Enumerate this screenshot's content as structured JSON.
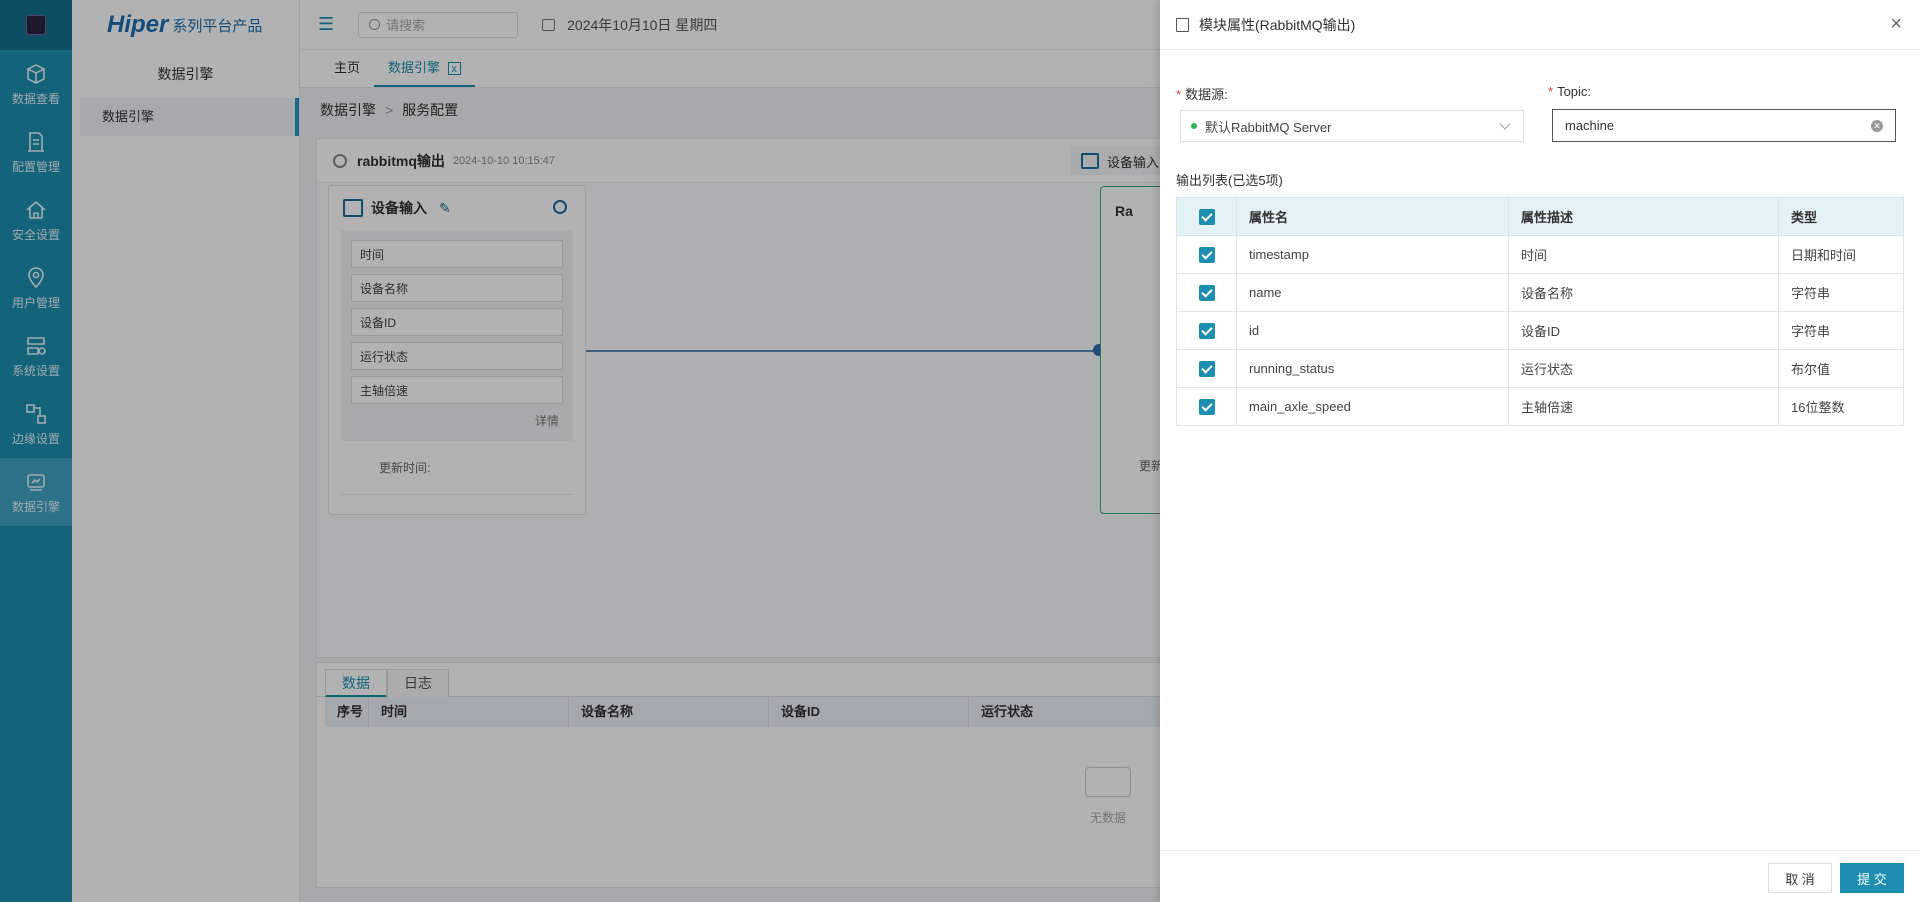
{
  "rail": {
    "items": [
      {
        "label": "数据查看",
        "icon": "cube-icon"
      },
      {
        "label": "配置管理",
        "icon": "config-icon"
      },
      {
        "label": "安全设置",
        "icon": "shield-home-icon"
      },
      {
        "label": "用户管理",
        "icon": "user-pin-icon"
      },
      {
        "label": "系统设置",
        "icon": "system-settings-icon"
      },
      {
        "label": "边缘设置",
        "icon": "edge-icon"
      },
      {
        "label": "数据引擎",
        "icon": "data-engine-icon"
      }
    ]
  },
  "brand": {
    "name": "Hiper",
    "suffix": "系列平台产品"
  },
  "subside": {
    "title": "数据引擎",
    "item": "数据引擎"
  },
  "topbar": {
    "search_placeholder": "请搜索",
    "date": "2024年10月10日 星期四"
  },
  "tabs": [
    {
      "label": "主页"
    },
    {
      "label": "数据引擎",
      "close": "x"
    }
  ],
  "breadcrumb": {
    "parent": "数据引擎",
    "sep": ">",
    "current": "服务配置"
  },
  "canvas": {
    "title": "rabbitmq输出",
    "timestamp": "2024-10-10 10:15:47",
    "tool_label": "设备输入"
  },
  "node": {
    "title": "设备输入",
    "fields": [
      "时间",
      "设备名称",
      "设备ID",
      "运行状态",
      "主轴倍速"
    ],
    "more": "详情",
    "updated": "更新时间:"
  },
  "node2": {
    "title": "Ra",
    "updated": "更新"
  },
  "datapanel": {
    "tabs": [
      "数据",
      "日志"
    ],
    "columns": [
      "序号",
      "时间",
      "设备名称",
      "设备ID",
      "运行状态"
    ],
    "empty": "无数据"
  },
  "drawer": {
    "title": "模块属性(RabbitMQ输出)",
    "close": "×",
    "datasource_label": "数据源:",
    "datasource_value": "默认RabbitMQ Server",
    "topic_label": "Topic:",
    "topic_value": "machine",
    "list_label": "输出列表(已选5项)",
    "table": {
      "headers": [
        "属性名",
        "属性描述",
        "类型"
      ],
      "rows": [
        {
          "name": "timestamp",
          "desc": "时间",
          "type": "日期和时间"
        },
        {
          "name": "name",
          "desc": "设备名称",
          "type": "字符串"
        },
        {
          "name": "id",
          "desc": "设备ID",
          "type": "字符串"
        },
        {
          "name": "running_status",
          "desc": "运行状态",
          "type": "布尔值"
        },
        {
          "name": "main_axle_speed",
          "desc": "主轴倍速",
          "type": "16位整数"
        }
      ]
    },
    "cancel": "取 消",
    "submit": "提 交"
  },
  "colors": {
    "primary": "#1c8fb0",
    "rail": "#1c8fb0",
    "status_ok": "#2fb455"
  }
}
